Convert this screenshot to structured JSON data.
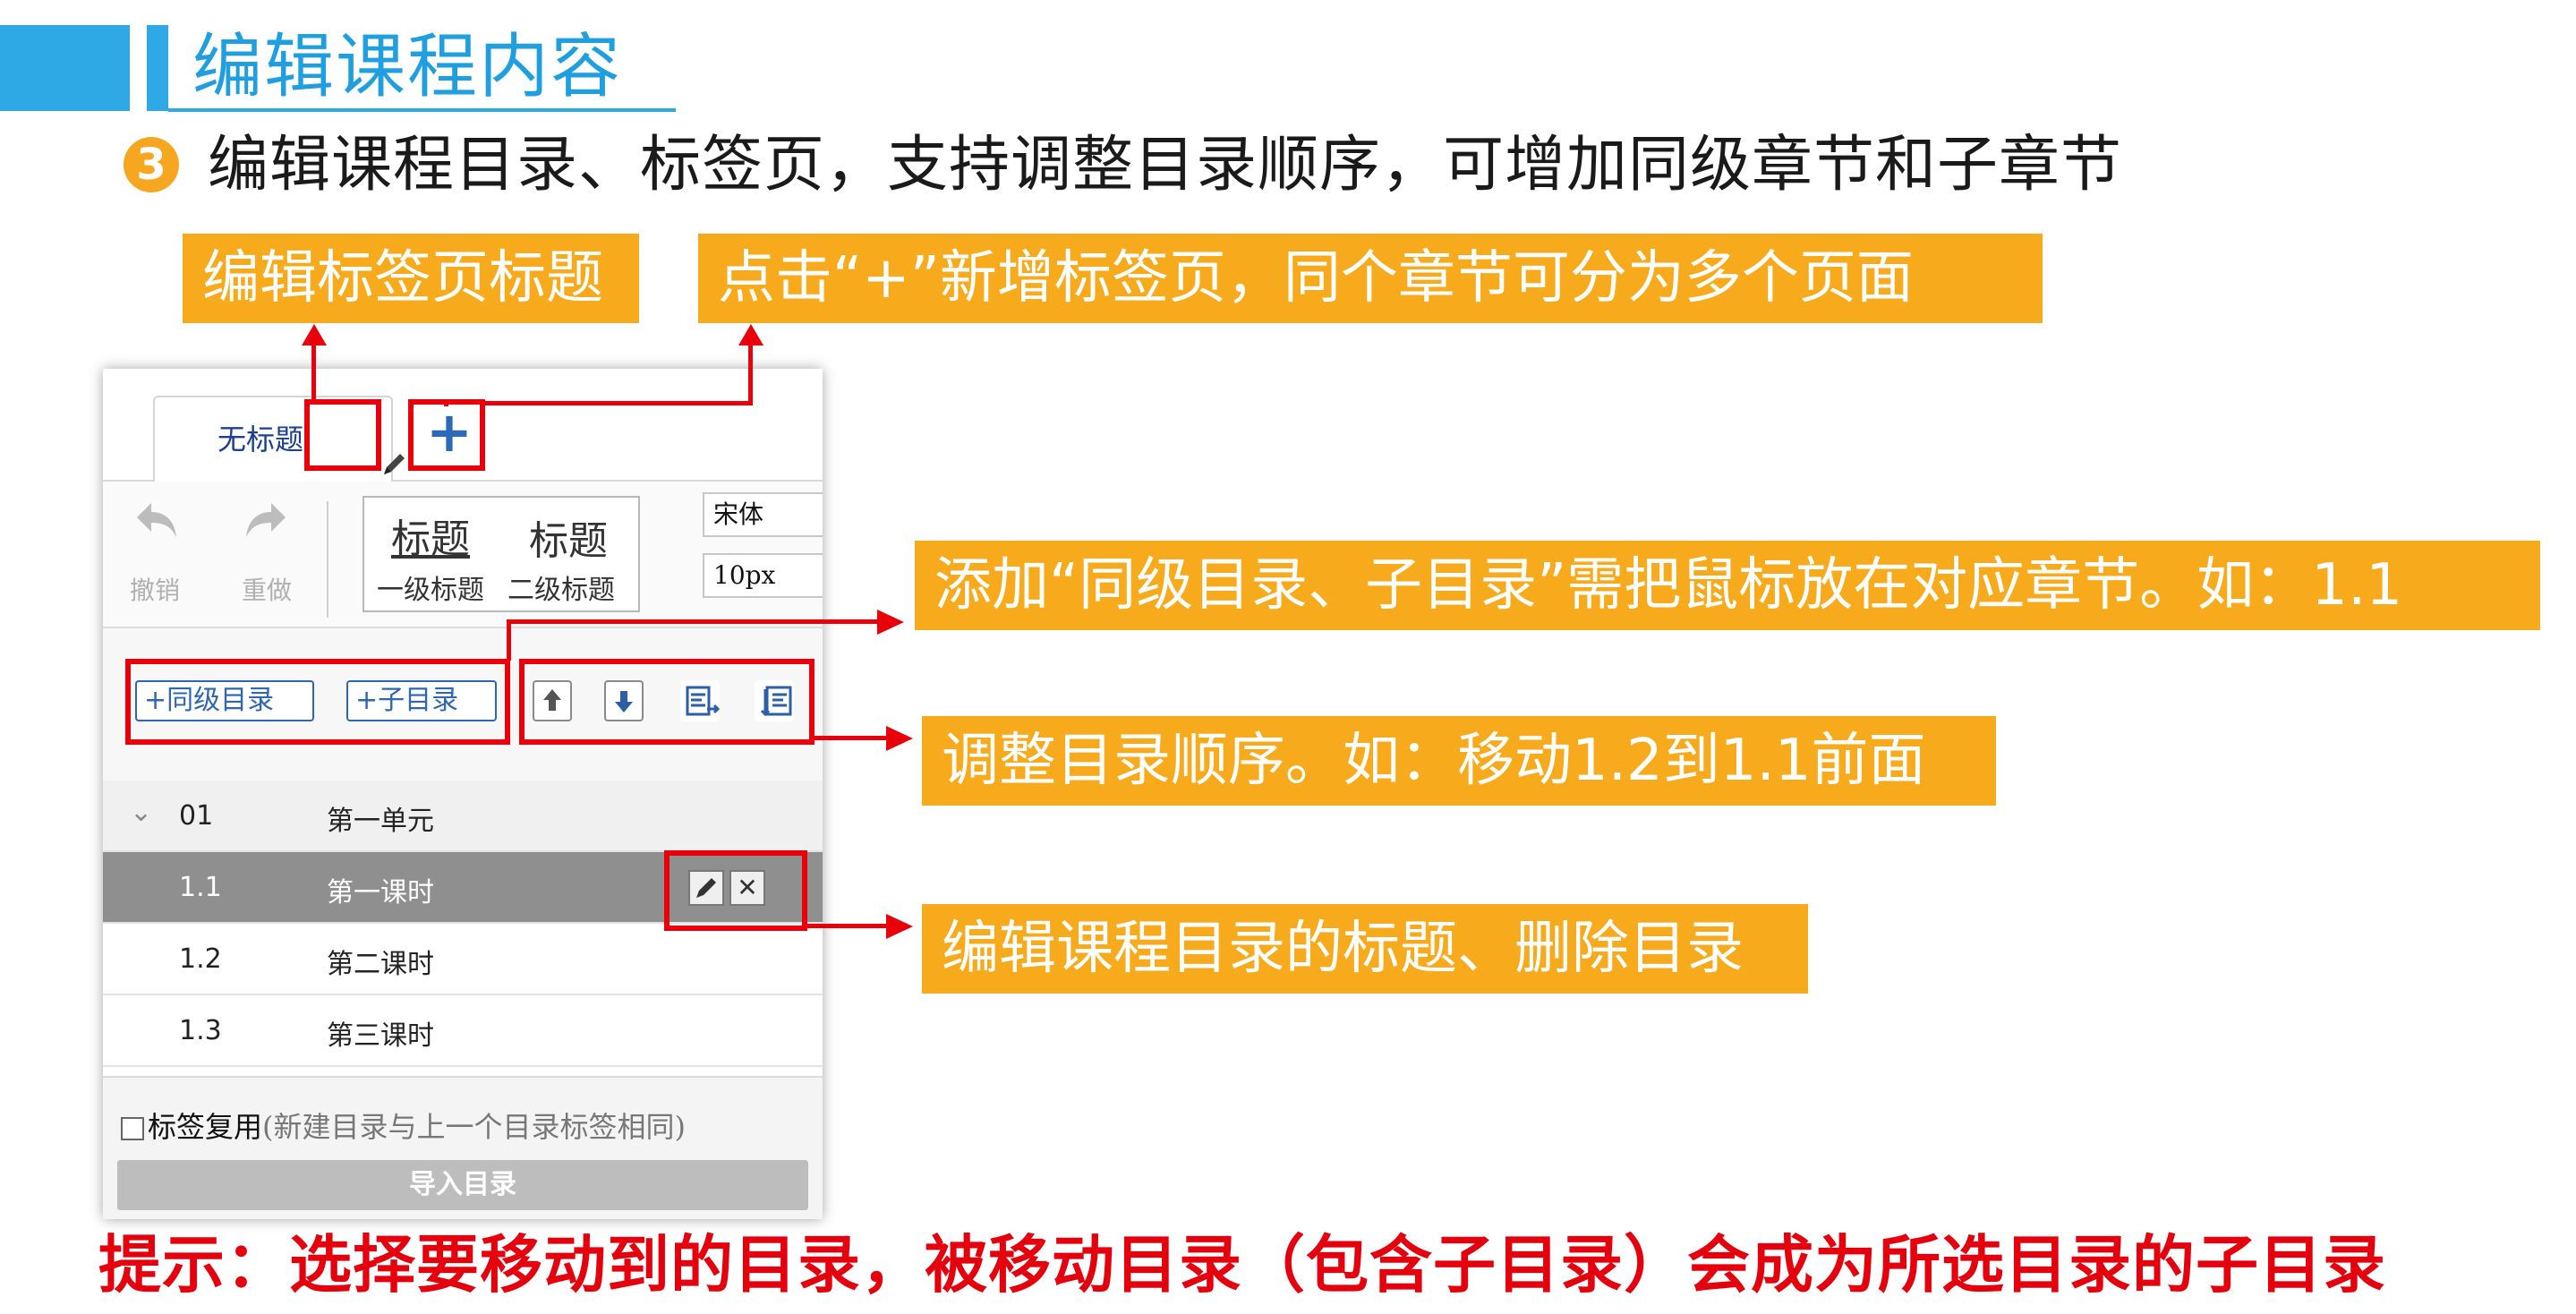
{
  "header": {
    "title": "编辑课程内容"
  },
  "point": {
    "number": "3",
    "text": "编辑课程目录、标签页，支持调整目录顺序，可增加同级章节和子章节"
  },
  "callouts": {
    "edit_tab_title": "编辑标签页标题",
    "add_tab": "点击“+”新增标签页，同个章节可分为多个页面",
    "add_directory": "添加“同级目录、子目录”需把鼠标放在对应章节。如：1.1",
    "reorder": "调整目录顺序。如：移动1.2到1.1前面",
    "edit_delete": "编辑课程目录的标题、删除目录"
  },
  "editor": {
    "tab_label": "无标题",
    "add_tab_symbol": "+",
    "toolbar": {
      "undo_label": "撤销",
      "redo_label": "重做",
      "heading1_big": "标题",
      "heading1_small": "一级标题",
      "heading2_big": "标题",
      "heading2_small": "二级标题",
      "font": "宋体",
      "size": "10px"
    },
    "actions": {
      "add_sibling": "+同级目录",
      "add_child": "+子目录"
    },
    "rows": [
      {
        "num": "01",
        "title": "第一单元"
      },
      {
        "num": "1.1",
        "title": "第一课时"
      },
      {
        "num": "1.2",
        "title": "第二课时"
      },
      {
        "num": "1.3",
        "title": "第三课时"
      }
    ],
    "reuse_label": "标签复用",
    "reuse_note": "(新建目录与上一个目录标签相同)",
    "import_label": "导入目录"
  },
  "tip": "提示：选择要移动到的目录，被移动目录（包含子目录）会成为所选目录的子目录",
  "colors": {
    "accent_blue": "#2fa9e6",
    "callout_orange": "#f7ab1c",
    "highlight_red": "#e8000b"
  },
  "icons": [
    "undo-icon",
    "redo-icon",
    "pencil-icon",
    "plus-icon",
    "move-up-icon",
    "move-down-icon",
    "indent-icon",
    "outdent-icon",
    "close-icon",
    "chevron-down-icon"
  ]
}
